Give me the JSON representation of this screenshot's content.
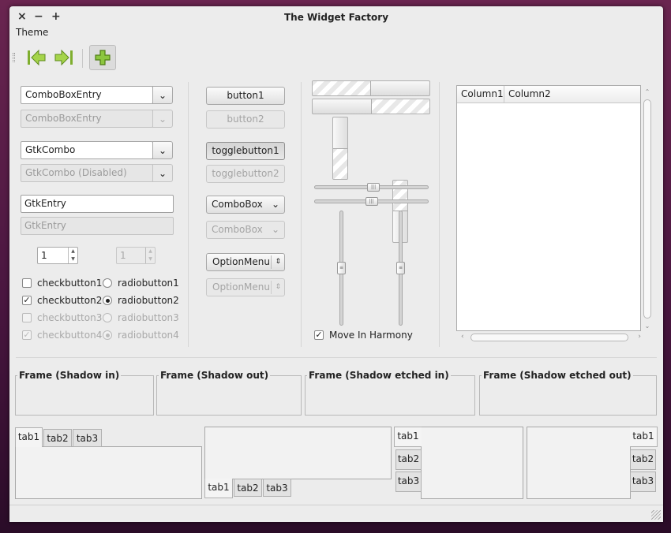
{
  "window": {
    "title": "The Widget Factory",
    "close": "×",
    "minimize": "−",
    "maximize": "+"
  },
  "menu": {
    "theme": "Theme"
  },
  "toolbar": {
    "back_icon": "go-previous-icon",
    "forward_icon": "go-next-icon",
    "add_icon": "add-icon"
  },
  "left": {
    "combo_entry": "ComboBoxEntry",
    "combo_entry_dis": "ComboBoxEntry",
    "gtk_combo": "GtkCombo",
    "gtk_combo_dis": "GtkCombo (Disabled)",
    "entry": "GtkEntry",
    "entry_dis": "GtkEntry",
    "spin": "1",
    "spin_dis": "1",
    "check1": "checkbutton1",
    "check2": "checkbutton2",
    "check3": "checkbutton3",
    "check4": "checkbutton4",
    "radio1": "radiobutton1",
    "radio2": "radiobutton2",
    "radio3": "radiobutton3",
    "radio4": "radiobutton4"
  },
  "middle": {
    "button1": "button1",
    "button2": "button2",
    "toggle1": "togglebutton1",
    "toggle2": "togglebutton2",
    "combo": "ComboBox",
    "combo_dis": "ComboBox",
    "option": "OptionMenu",
    "option_dis": "OptionMenu"
  },
  "sliders": {
    "progress_h1": 0.5,
    "progress_h2": 0.5,
    "progress_v1": 0.5,
    "progress_v2": 0.5,
    "scale_h1": 0.52,
    "scale_h2": 0.5,
    "scale_v1": 0.5,
    "scale_v2": 0.5,
    "harmony": "Move In Harmony"
  },
  "tree": {
    "col1": "Column1",
    "col2": "Column2"
  },
  "frames": [
    "Frame (Shadow in)",
    "Frame (Shadow out)",
    "Frame (Shadow etched in)",
    "Frame (Shadow etched out)"
  ],
  "tabs": [
    "tab1",
    "tab2",
    "tab3"
  ]
}
